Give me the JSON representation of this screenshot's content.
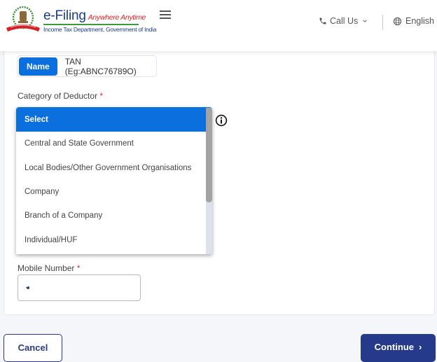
{
  "header": {
    "brand_name": "e-Filing",
    "brand_tagline": "Anywhere Anytime",
    "brand_subtitle": "Income Tax Department, Government of India",
    "menu_icon": "hamburger-icon",
    "call_us_label": "Call Us",
    "call_us_icon": "phone-icon",
    "language_label": "English",
    "language_icon": "globe-icon"
  },
  "form": {
    "search_mode": {
      "options": [
        {
          "label": "Name",
          "active": true
        },
        {
          "label": "TAN (Eg:ABNC76789O)",
          "active": false
        }
      ]
    },
    "category": {
      "label": "Category of Deductor",
      "required_mark": "*",
      "info_icon": "info-icon",
      "options": [
        {
          "label": "Select",
          "selected": true
        },
        {
          "label": "Central and State Government",
          "selected": false
        },
        {
          "label": "Local Bodies/Other Government Organisations",
          "selected": false
        },
        {
          "label": "Company",
          "selected": false
        },
        {
          "label": "Branch of a Company",
          "selected": false
        },
        {
          "label": "Individual/HUF",
          "selected": false
        }
      ]
    },
    "mobile": {
      "label": "Mobile Number",
      "required_mark": "*",
      "country": "India",
      "value": ""
    }
  },
  "actions": {
    "cancel_label": "Cancel",
    "continue_label": "Continue",
    "continue_arrow": "›"
  },
  "colors": {
    "primary": "#0b6fde",
    "navy": "#253a8a",
    "required": "#d32f2f"
  }
}
